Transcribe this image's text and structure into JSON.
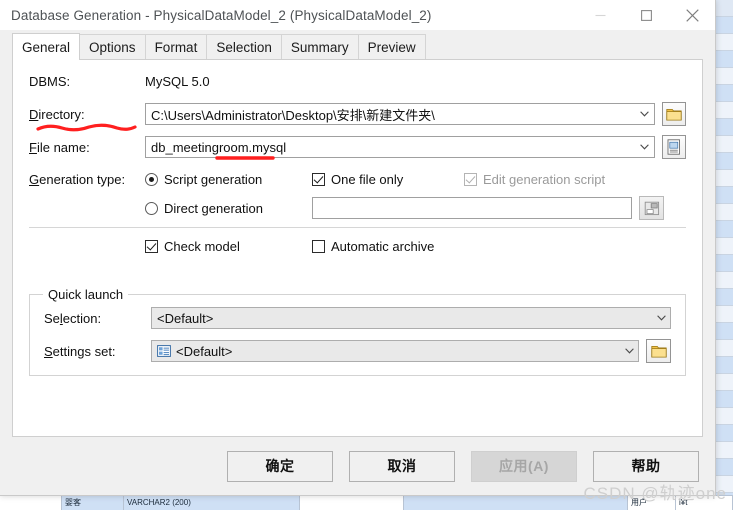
{
  "window": {
    "title": "Database Generation - PhysicalDataModel_2 (PhysicalDataModel_2)",
    "minimize_label": "minimize",
    "maximize_label": "maximize",
    "close_label": "close"
  },
  "tabs": [
    {
      "label": "General",
      "active": true
    },
    {
      "label": "Options",
      "active": false
    },
    {
      "label": "Format",
      "active": false
    },
    {
      "label": "Selection",
      "active": false
    },
    {
      "label": "Summary",
      "active": false
    },
    {
      "label": "Preview",
      "active": false
    }
  ],
  "general": {
    "dbms_label": "DBMS:",
    "dbms_value": "MySQL 5.0",
    "directory_label": "Directory:",
    "directory_accel": "D",
    "directory_value": "C:\\Users\\Administrator\\Desktop\\安排\\新建文件夹\\",
    "directory_browse_icon": "folder-icon",
    "filename_label": "File name:",
    "filename_accel": "F",
    "filename_value": "db_meetingroom.mysql",
    "filename_browse_icon": "document-icon",
    "gen_type_label": "Generation type:",
    "gen_type_accel": "G",
    "script_generation_label": "Script generation",
    "script_generation_accel": "S",
    "script_generation_selected": true,
    "direct_generation_label": "Direct generation",
    "direct_generation_accel": "D",
    "direct_generation_selected": false,
    "one_file_only_label": "One file only",
    "one_file_only_accel": "n",
    "one_file_only_checked": true,
    "edit_generation_script_label": "Edit generation script",
    "edit_generation_script_accel": "E",
    "edit_generation_script_checked": true,
    "edit_generation_script_disabled": true,
    "direct_connection_value": "",
    "direct_connection_icon": "database-connect-icon",
    "check_model_label": "Check model",
    "check_model_accel": "C",
    "check_model_checked": true,
    "automatic_archive_label": "Automatic archive",
    "automatic_archive_accel": "a",
    "automatic_archive_checked": false
  },
  "quick_launch": {
    "group_title": "Quick launch",
    "selection_label": "Selection:",
    "selection_accel": "l",
    "selection_value": "<Default>",
    "settings_set_label": "Settings set:",
    "settings_set_accel": "S",
    "settings_set_value": "<Default>",
    "settings_set_icon": "settings-list-icon",
    "settings_set_browse_icon": "folder-icon"
  },
  "footer": {
    "ok_label": "确定",
    "cancel_label": "取消",
    "apply_label": "应用(A)",
    "apply_disabled": true,
    "help_label": "帮助"
  },
  "annotations": {
    "directory_underline_color": "#ff1f1f",
    "filename_underline_color": "#ff1f1f"
  },
  "watermark": {
    "text": "CSDN @轨迹one"
  },
  "background": {
    "right_column_cells": [
      "",
      "",
      "",
      "",
      "",
      "",
      "",
      "",
      "",
      "",
      "",
      "",
      "",
      "",
      "",
      "",
      "",
      "",
      "",
      "",
      "",
      "",
      "",
      "",
      "",
      "",
      "",
      ""
    ],
    "bottom_row_cells": [
      "",
      "婴客",
      "VARCHAR2 (200)",
      "",
      "",
      "",
      "",
      "",
      "用户",
      "i¥t"
    ]
  },
  "colors": {
    "dialog_bg": "#f0f0f0",
    "panel_bg": "#ffffff",
    "accent_folder": "#f5c349",
    "accent_blue": "#3a6ea5",
    "annotation_red": "#ff1f1f"
  }
}
